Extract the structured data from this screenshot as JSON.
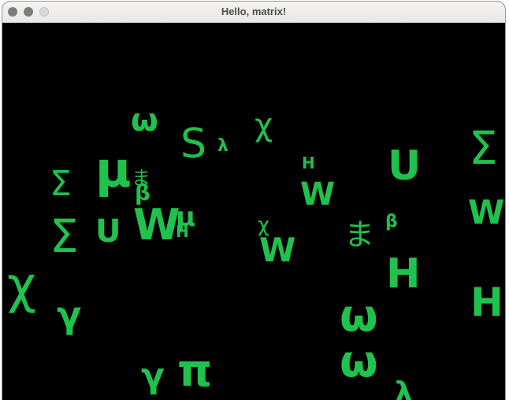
{
  "window": {
    "title": "Hello, matrix!"
  },
  "colors": {
    "glyph": "#1fc24c",
    "background": "#000000"
  },
  "glyphs": [
    {
      "char": "ω"
    },
    {
      "char": "S"
    },
    {
      "char": "λ"
    },
    {
      "char": "χ"
    },
    {
      "char": "Σ"
    },
    {
      "char": "μ"
    },
    {
      "char": "ま"
    },
    {
      "char": "β"
    },
    {
      "char": "Σ"
    },
    {
      "char": "H"
    },
    {
      "char": "W"
    },
    {
      "char": "U"
    },
    {
      "char": "Σ"
    },
    {
      "char": "U"
    },
    {
      "char": "W"
    },
    {
      "char": "μ"
    },
    {
      "char": "H"
    },
    {
      "char": "χ"
    },
    {
      "char": "W"
    },
    {
      "char": "ま"
    },
    {
      "char": "β"
    },
    {
      "char": "W"
    },
    {
      "char": "H"
    },
    {
      "char": "χ"
    },
    {
      "char": "γ"
    },
    {
      "char": "H"
    },
    {
      "char": "ω"
    },
    {
      "char": "ω"
    },
    {
      "char": "γ"
    },
    {
      "char": "π"
    },
    {
      "char": "λ"
    }
  ]
}
